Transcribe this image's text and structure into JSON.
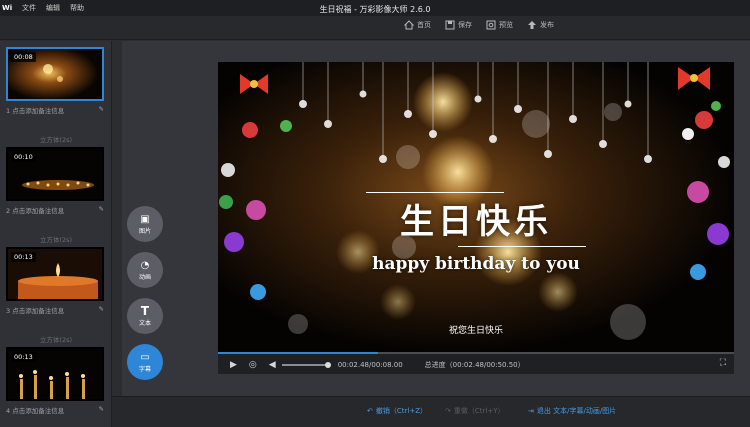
{
  "app": {
    "logo": "Wi",
    "title": "生日祝福 - 万彩影像大师 2.6.0",
    "menu": [
      "文件",
      "编辑",
      "帮助"
    ]
  },
  "toolbar": {
    "home": "首页",
    "save": "保存",
    "preview": "预览",
    "publish": "发布"
  },
  "scenes": [
    {
      "duration": "00:08",
      "label": "1  点击添加备注信息",
      "active": true
    },
    {
      "duration": "00:10",
      "label": "2  点击添加备注信息",
      "active": false
    },
    {
      "duration": "00:13",
      "label": "3  点击添加备注信息",
      "active": false
    },
    {
      "duration": "00:13",
      "label": "4  点击添加备注信息",
      "active": false
    }
  ],
  "transitions": [
    "立方体(2s)",
    "立方体(2s)",
    "立方体(2s)"
  ],
  "tools": [
    {
      "icon": "image-icon",
      "label": "图片"
    },
    {
      "icon": "animation-icon",
      "label": "动画"
    },
    {
      "icon": "text-icon",
      "label": "文本"
    },
    {
      "icon": "subtitle-icon",
      "label": "字幕"
    }
  ],
  "preview": {
    "title_cn": "生日快乐",
    "title_en": "happy birthday to you",
    "caption": "祝您生日快乐"
  },
  "player": {
    "progress": 0.31,
    "current_time": "00:02.48/00:08.00",
    "total_time": "总进度（00:02.48/00:50.50）"
  },
  "bottom": {
    "undo": "撤销（Ctrl+Z）",
    "redo": "重做（Ctrl+Y）",
    "export": "退出 文本/字幕/动画/图片"
  },
  "colors": {
    "accent": "#2f86d6"
  }
}
